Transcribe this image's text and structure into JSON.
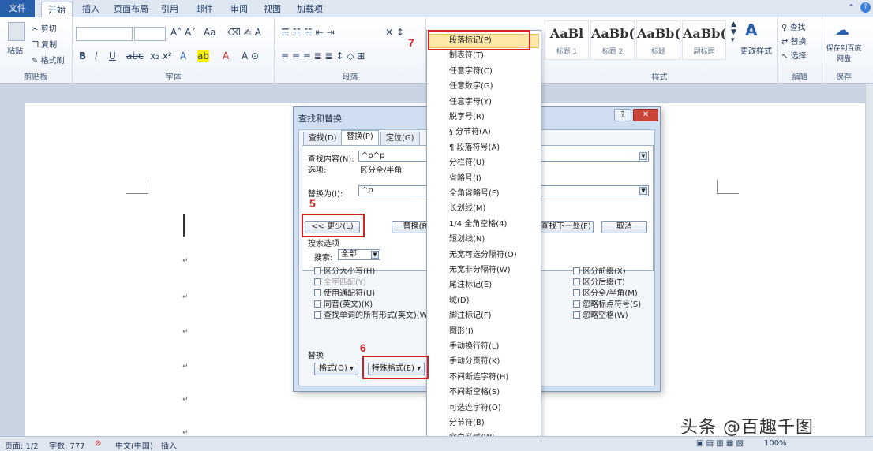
{
  "tabs": {
    "file": "文件",
    "items": [
      "开始",
      "插入",
      "页面布局",
      "引用",
      "邮件",
      "审阅",
      "视图",
      "加载项"
    ]
  },
  "window_controls": [
    "⌃",
    "?"
  ],
  "ribbon": {
    "clipboard": {
      "paste": "粘贴",
      "cut": "剪切",
      "copy": "复制",
      "format_painter": "格式刷",
      "label": "剪贴板"
    },
    "font": {
      "label": "字体"
    },
    "paragraph": {
      "label": "段落"
    },
    "styles": {
      "label": "样式",
      "tiles": [
        {
          "sample": "AaBl",
          "name": "标题 1"
        },
        {
          "sample": "AaBb(",
          "name": "标题 2"
        },
        {
          "sample": "AaBb(",
          "name": "标题"
        },
        {
          "sample": "AaBb(",
          "name": "副标题"
        }
      ],
      "change_styles": "更改样式"
    },
    "editing": {
      "find": "查找",
      "replace": "替换",
      "select": "选择",
      "label": "编辑"
    },
    "save": {
      "button": "保存到百度网盘",
      "label": "保存"
    }
  },
  "dialog": {
    "title": "查找和替换",
    "tabs": [
      "查找(D)",
      "替换(P)",
      "定位(G)"
    ],
    "find_label": "查找内容(N):",
    "find_value": "^p^p",
    "options_label": "选项:",
    "options_value": "区分全/半角",
    "replace_label": "替换为(I):",
    "replace_value": "^p",
    "less_button": "<< 更少(L)",
    "replace_button": "替换(R)",
    "find_next_button": "查找下一处(F)",
    "cancel_button": "取消",
    "search_options_label": "搜索选项",
    "search_label": "搜索:",
    "search_value": "全部",
    "checkboxes_left": [
      "区分大小写(H)",
      "全字匹配(Y)",
      "使用通配符(U)",
      "同音(英文)(K)",
      "查找单词的所有形式(英文)(W)"
    ],
    "checkboxes_right": [
      "区分前缀(X)",
      "区分后缀(T)",
      "区分全/半角(M)",
      "忽略标点符号(S)",
      "忽略空格(W)"
    ],
    "replace_section": "替换",
    "format_button": "格式(O) ▾",
    "special_button": "特殊格式(E) ▾"
  },
  "special_menu": [
    "段落标记(P)",
    "制表符(T)",
    "任意字符(C)",
    "任意数字(G)",
    "任意字母(Y)",
    "脱字号(R)",
    "§ 分节符(A)",
    "¶ 段落符号(A)",
    "分栏符(U)",
    "省略号(I)",
    "全角省略号(F)",
    "长划线(M)",
    "1/4 全角空格(4)",
    "短划线(N)",
    "无宽可选分隔符(O)",
    "无宽非分隔符(W)",
    "尾注标记(E)",
    "域(D)",
    "脚注标记(F)",
    "图形(I)",
    "手动换行符(L)",
    "手动分页符(K)",
    "不间断连字符(H)",
    "不间断空格(S)",
    "可选连字符(O)",
    "分节符(B)",
    "空白区域(W)"
  ],
  "annotations": [
    "5",
    "6",
    "7"
  ],
  "status_bar": {
    "page": "页面: 1/2",
    "words": "字数: 777",
    "language": "中文(中国)",
    "mode": "插入",
    "zoom": "100%"
  },
  "watermark": "头条 @百趣千图",
  "colors": {
    "accent": "#2a5fab",
    "annotation": "#d42020",
    "menu_highlight": "#fde8a8"
  }
}
